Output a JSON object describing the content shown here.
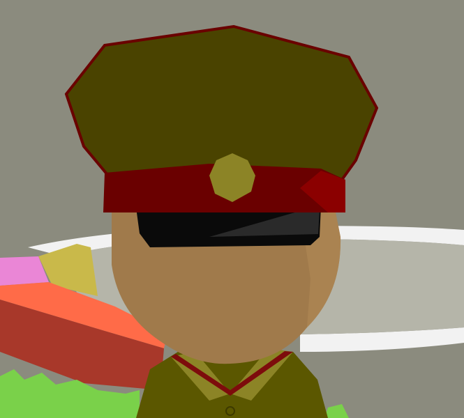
{
  "scene": {
    "colors": {
      "sky": "#8b8b7e",
      "ring": "#f2f2f2",
      "ring_inner": "#b5b5a9",
      "arena_yellow": "#c9b94a",
      "arena_pink": "#ea86d6",
      "arena_orange": "#ff6b48",
      "arena_orange_shadow": "#a8382a",
      "grass": "#7ad14a",
      "skin": "#a07a4b",
      "cap_olive": "#4a4300",
      "cap_band": "#6a0000",
      "cap_badge": "#8c8426",
      "visor": "#0a0a0a",
      "uniform": "#5b5700",
      "collar_trim": "#7d0c0c"
    },
    "character": {
      "headwear": "peaked-military-cap",
      "eyewear": "dark-visor",
      "outfit": "olive-uniform"
    }
  }
}
